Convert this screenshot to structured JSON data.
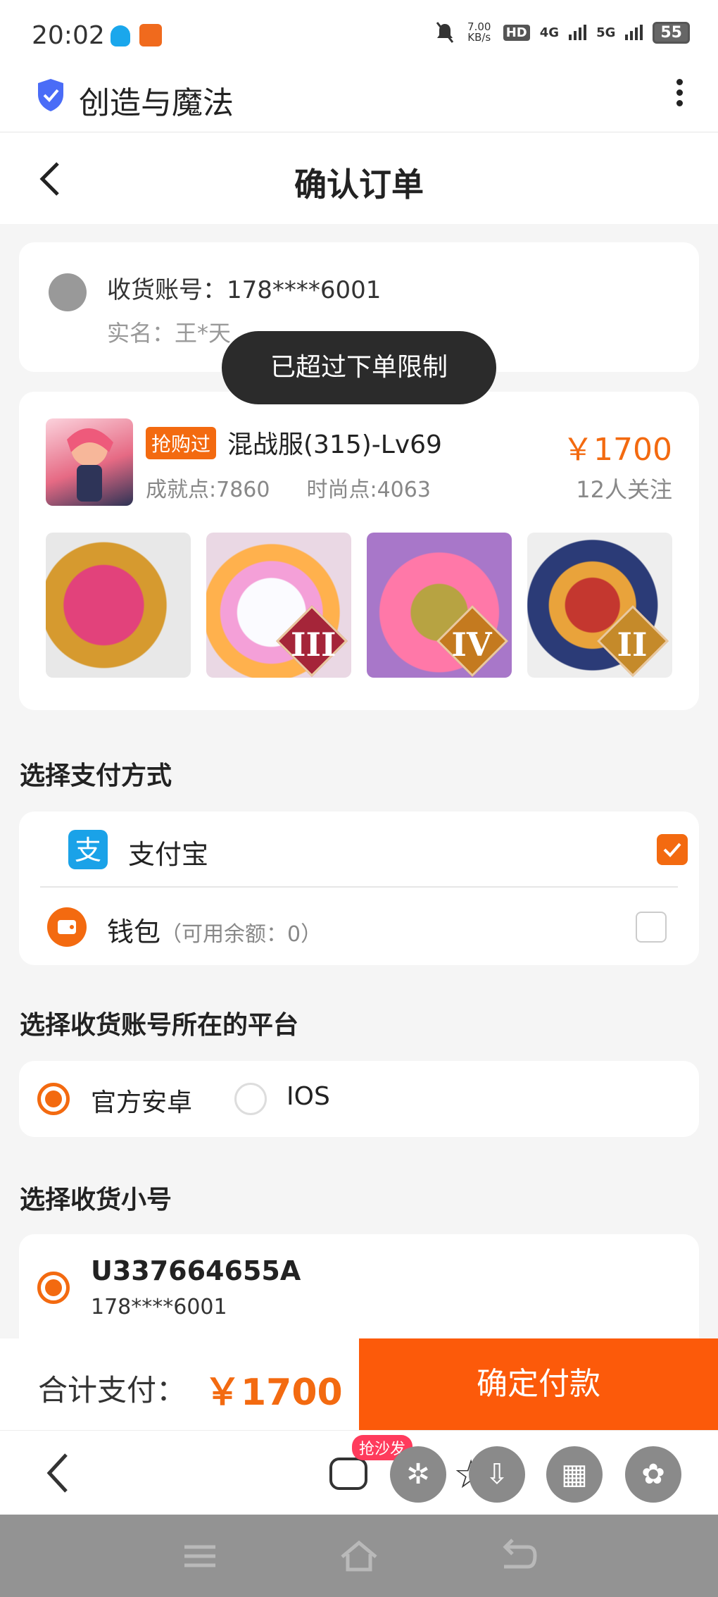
{
  "status_bar": {
    "time": "20:02",
    "net_speed": "7.00 KB/s",
    "hd": "HD",
    "net4g": "4G",
    "net5g": "5G",
    "battery": "55"
  },
  "app_bar": {
    "title": "创造与魔法"
  },
  "page": {
    "title": "确认订单"
  },
  "account": {
    "line1": "收货账号：178****6001",
    "line2": "实名：王*天"
  },
  "toast": "已超过下单限制",
  "product": {
    "tag": "抢购过",
    "name": "混战服(315)-Lv69",
    "price": "￥1700",
    "achievement": "成就点:7860",
    "fashion": "时尚点:4063",
    "follows": "12人关注",
    "pet_badges": [
      "",
      "III",
      "IV",
      "II"
    ]
  },
  "payment": {
    "section_title": "选择支付方式",
    "options": [
      {
        "label": "支付宝",
        "sub": "",
        "checked": true
      },
      {
        "label": "钱包",
        "sub": "（可用余额：0）",
        "checked": false
      }
    ]
  },
  "platform": {
    "section_title": "选择收货账号所在的平台",
    "options": [
      {
        "label": "官方安卓",
        "selected": true
      },
      {
        "label": "IOS",
        "selected": false
      }
    ]
  },
  "small_account": {
    "section_title": "选择收货小号",
    "uid": "U337664655A",
    "phone": "178****6001"
  },
  "pay_bar": {
    "total_label": "合计支付：",
    "total_amount": "￥1700",
    "confirm_label": "确定付款"
  },
  "browser": {
    "hot_tag": "抢沙发"
  },
  "colors": {
    "accent": "#f36a10",
    "confirm_bg": "#fc5a0a",
    "alipay": "#1aa2e8"
  }
}
